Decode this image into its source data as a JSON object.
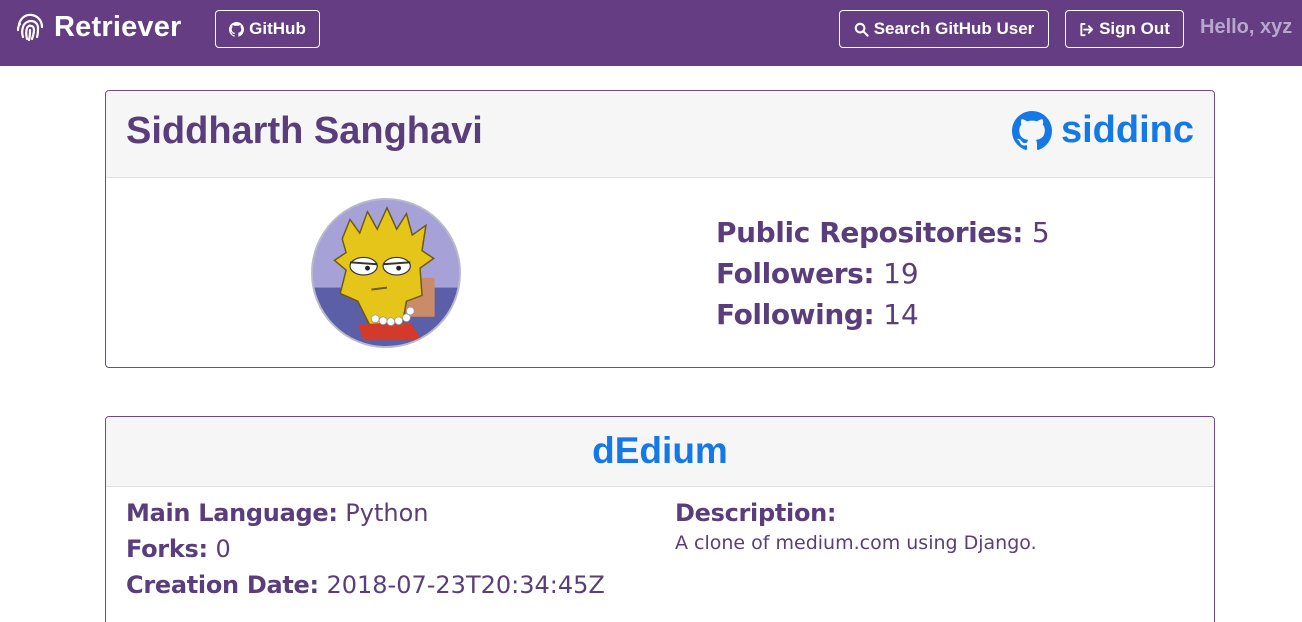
{
  "navbar": {
    "brand": "Retriever",
    "brand_icon": "fingerprint-icon",
    "github_label": "GitHub",
    "search_label": "Search GitHub User",
    "signout_label": "Sign Out",
    "greeting": "Hello, xyz",
    "color": "#643d82"
  },
  "profile": {
    "name": "Siddharth Sanghavi",
    "login": "siddinc",
    "login_icon": "github-icon",
    "avatar": "user-avatar",
    "stats": [
      {
        "label": "Public Repositories:",
        "value": "5"
      },
      {
        "label": "Followers:",
        "value": "19"
      },
      {
        "label": "Following:",
        "value": "14"
      }
    ]
  },
  "repo": {
    "name": "dEdium",
    "language_label": "Main Language:",
    "language": "Python",
    "forks_label": "Forks:",
    "forks": "0",
    "created_label": "Creation Date:",
    "created": "2018-07-23T20:34:45Z",
    "description_label": "Description:",
    "description": "A clone of medium.com using Django."
  },
  "colors": {
    "accent": "#643d82",
    "link": "#1479e6",
    "text": "#5a3e7c"
  }
}
